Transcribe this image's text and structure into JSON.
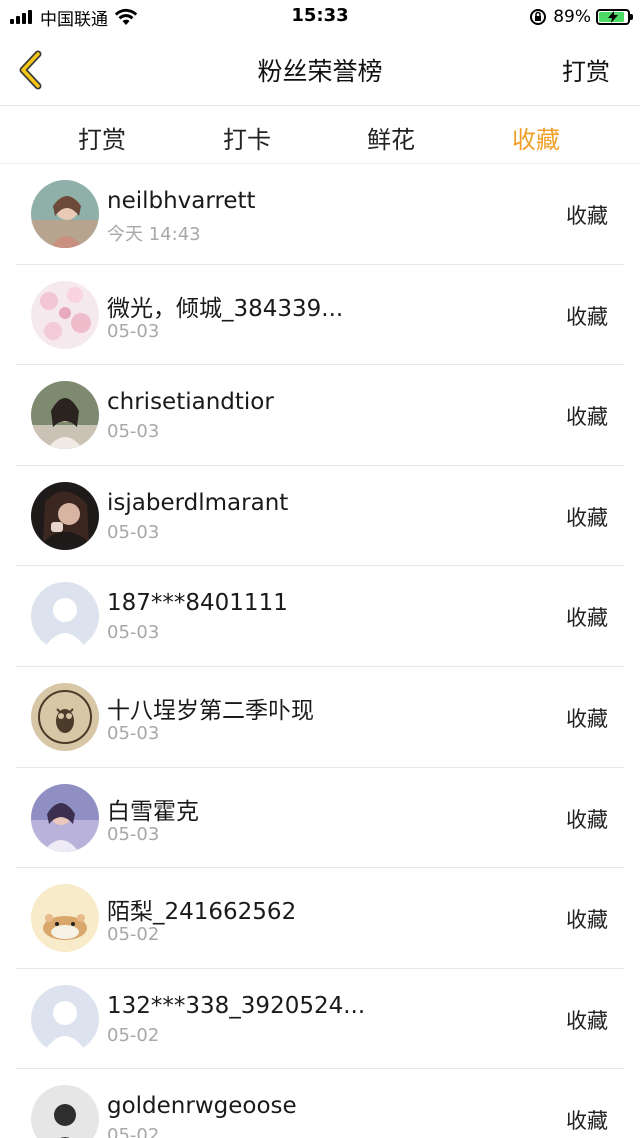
{
  "status_bar": {
    "carrier": "中国联通",
    "time": "15:33",
    "battery": "89%",
    "battery_level": 0.89
  },
  "nav": {
    "title": "粉丝荣誉榜",
    "action": "打赏"
  },
  "tabs": [
    {
      "label": "打赏",
      "active": false
    },
    {
      "label": "打卡",
      "active": false
    },
    {
      "label": "鲜花",
      "active": false
    },
    {
      "label": "收藏",
      "active": true
    }
  ],
  "accent_color": "#f0a02a",
  "fans": [
    {
      "name": "neilbhvarrett",
      "date": "今天 14:43",
      "action": "收藏",
      "avatar": "photo-girl-icon"
    },
    {
      "name": "微光，倾城_384339...",
      "date": "05-03",
      "action": "收藏",
      "avatar": "pink-blossom-icon"
    },
    {
      "name": "chrisetiandtior",
      "date": "05-03",
      "action": "收藏",
      "avatar": "photo-woman-icon"
    },
    {
      "name": "isjaberdlmarant",
      "date": "05-03",
      "action": "收藏",
      "avatar": "photo-dark-woman-icon"
    },
    {
      "name": "187***8401111",
      "date": "05-03",
      "action": "收藏",
      "avatar": "default-user-icon"
    },
    {
      "name": "十八埕岁第二季卟现",
      "date": "05-03",
      "action": "收藏",
      "avatar": "owl-badge-icon"
    },
    {
      "name": "白雪霍克",
      "date": "05-03",
      "action": "收藏",
      "avatar": "photo-purple-icon"
    },
    {
      "name": "陌梨_241662562",
      "date": "05-02",
      "action": "收藏",
      "avatar": "hamster-icon"
    },
    {
      "name": "132***338_3920524...",
      "date": "05-02",
      "action": "收藏",
      "avatar": "default-user-icon"
    },
    {
      "name": "goldenrwgeoose",
      "date": "05-02",
      "action": "收藏",
      "avatar": "photo-bw-icon"
    }
  ]
}
